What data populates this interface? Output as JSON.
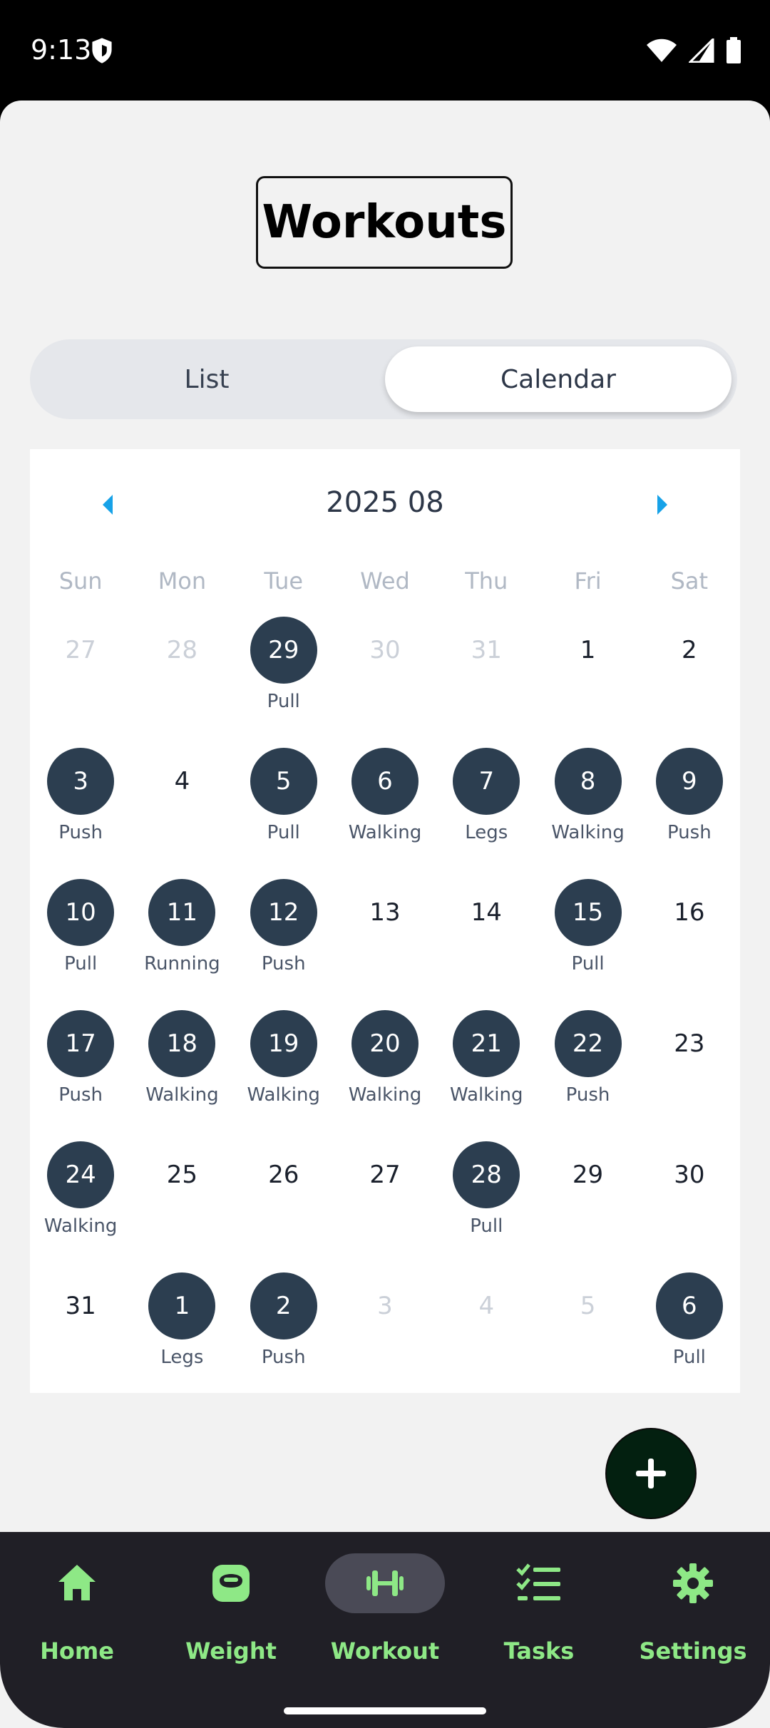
{
  "status": {
    "time": "9:13"
  },
  "header": {
    "title": "Workouts"
  },
  "tabs": {
    "list": "List",
    "calendar": "Calendar"
  },
  "calendar": {
    "month": "2025 08",
    "weekdays": [
      "Sun",
      "Mon",
      "Tue",
      "Wed",
      "Thu",
      "Fri",
      "Sat"
    ],
    "weeks": [
      [
        {
          "d": "27",
          "m": true
        },
        {
          "d": "28",
          "m": true
        },
        {
          "d": "29",
          "m": true,
          "w": "Pull"
        },
        {
          "d": "30",
          "m": true
        },
        {
          "d": "31",
          "m": true
        },
        {
          "d": "1"
        },
        {
          "d": "2"
        }
      ],
      [
        {
          "d": "3",
          "w": "Push"
        },
        {
          "d": "4"
        },
        {
          "d": "5",
          "w": "Pull"
        },
        {
          "d": "6",
          "w": "Walking"
        },
        {
          "d": "7",
          "w": "Legs"
        },
        {
          "d": "8",
          "w": "Walking"
        },
        {
          "d": "9",
          "w": "Push"
        }
      ],
      [
        {
          "d": "10",
          "w": "Pull"
        },
        {
          "d": "11",
          "w": "Running"
        },
        {
          "d": "12",
          "w": "Push"
        },
        {
          "d": "13"
        },
        {
          "d": "14"
        },
        {
          "d": "15",
          "w": "Pull"
        },
        {
          "d": "16"
        }
      ],
      [
        {
          "d": "17",
          "w": "Push"
        },
        {
          "d": "18",
          "w": "Walking"
        },
        {
          "d": "19",
          "w": "Walking"
        },
        {
          "d": "20",
          "w": "Walking"
        },
        {
          "d": "21",
          "w": "Walking"
        },
        {
          "d": "22",
          "w": "Push"
        },
        {
          "d": "23"
        }
      ],
      [
        {
          "d": "24",
          "w": "Walking"
        },
        {
          "d": "25"
        },
        {
          "d": "26"
        },
        {
          "d": "27"
        },
        {
          "d": "28",
          "w": "Pull"
        },
        {
          "d": "29"
        },
        {
          "d": "30"
        }
      ],
      [
        {
          "d": "31"
        },
        {
          "d": "1",
          "m": true,
          "w": "Legs"
        },
        {
          "d": "2",
          "m": true,
          "w": "Push"
        },
        {
          "d": "3",
          "m": true
        },
        {
          "d": "4",
          "m": true
        },
        {
          "d": "5",
          "m": true
        },
        {
          "d": "6",
          "m": true,
          "w": "Pull"
        }
      ]
    ]
  },
  "fab": {
    "icon": "plus-icon"
  },
  "nav": [
    {
      "label": "Home",
      "icon": "home-icon"
    },
    {
      "label": "Weight",
      "icon": "kettlebell-icon"
    },
    {
      "label": "Workout",
      "icon": "dumbbell-icon",
      "active": true
    },
    {
      "label": "Tasks",
      "icon": "checklist-icon"
    },
    {
      "label": "Settings",
      "icon": "gear-icon"
    }
  ],
  "colors": {
    "accent": "#8ee886",
    "workout_circle": "#2c3e50",
    "nav_bg": "#201f26",
    "fab": "#032010",
    "arrow": "#17a2e8"
  }
}
